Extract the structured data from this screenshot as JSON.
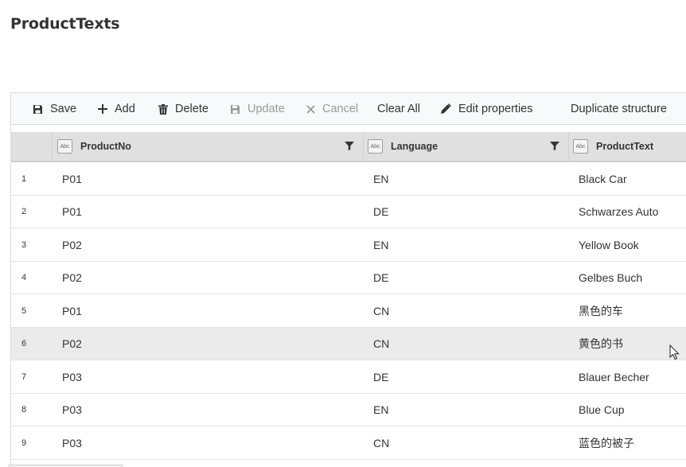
{
  "page": {
    "title": "ProductTexts"
  },
  "toolbar": {
    "save": "Save",
    "add": "Add",
    "delete": "Delete",
    "update": "Update",
    "cancel": "Cancel",
    "clear_all": "Clear All",
    "edit_properties": "Edit properties",
    "duplicate_structure": "Duplicate structure"
  },
  "columns": [
    {
      "label": "ProductNo",
      "type_badge": "Abc"
    },
    {
      "label": "Language",
      "type_badge": "Abc"
    },
    {
      "label": "ProductText",
      "type_badge": "Abc"
    }
  ],
  "rows": [
    {
      "num": "1",
      "product_no": "P01",
      "language": "EN",
      "product_text": "Black Car"
    },
    {
      "num": "2",
      "product_no": "P01",
      "language": "DE",
      "product_text": "Schwarzes Auto"
    },
    {
      "num": "3",
      "product_no": "P02",
      "language": "EN",
      "product_text": "Yellow Book"
    },
    {
      "num": "4",
      "product_no": "P02",
      "language": "DE",
      "product_text": "Gelbes Buch"
    },
    {
      "num": "5",
      "product_no": "P01",
      "language": "CN",
      "product_text": "黑色的车"
    },
    {
      "num": "6",
      "product_no": "P02",
      "language": "CN",
      "product_text": "黄色的书"
    },
    {
      "num": "7",
      "product_no": "P03",
      "language": "DE",
      "product_text": "Blauer Becher"
    },
    {
      "num": "8",
      "product_no": "P03",
      "language": "EN",
      "product_text": "Blue Cup"
    },
    {
      "num": "9",
      "product_no": "P03",
      "language": "CN",
      "product_text": "蓝色的被子"
    }
  ],
  "selected_row": "6",
  "icons": {
    "save": "save-icon",
    "add": "plus-icon",
    "delete": "trash-icon",
    "update": "save-icon",
    "cancel": "close-icon",
    "edit_properties": "pencil-icon",
    "filter": "filter-icon",
    "cursor": "mouse-pointer-icon"
  },
  "colors": {
    "toolbar_bg": "#f8f9fa",
    "header_bg": "#e0e0e0",
    "selected_row_bg": "#ebebeb",
    "disabled_text": "#9a9a9a"
  }
}
